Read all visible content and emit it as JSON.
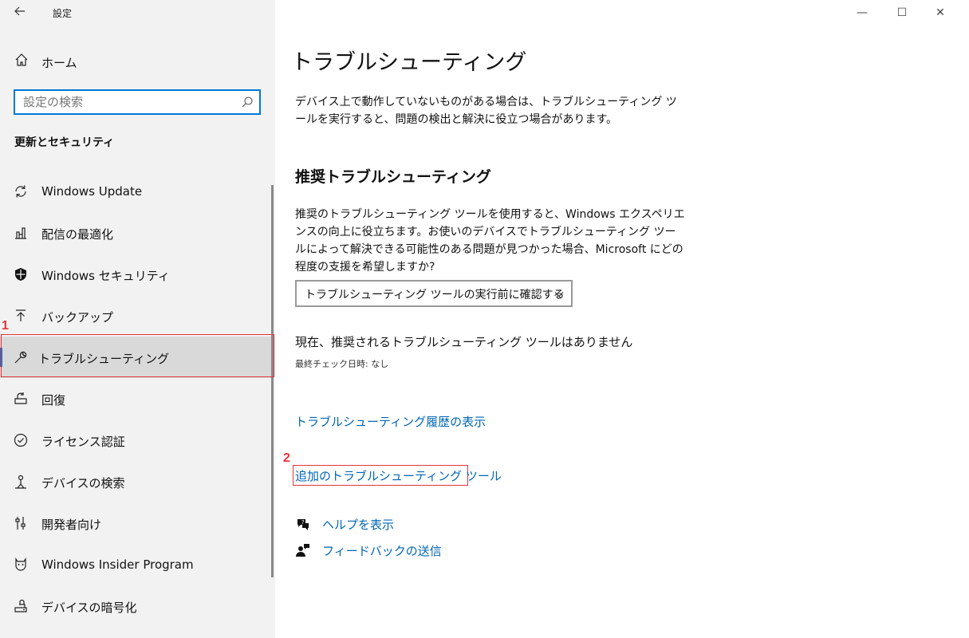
{
  "window": {
    "title": "設定",
    "controls": {
      "minimize": "—",
      "maximize": "☐",
      "close": "✕"
    }
  },
  "sidebar": {
    "home_label": "ホーム",
    "search_placeholder": "設定の検索",
    "section_heading": "更新とセキュリティ",
    "items": [
      {
        "label": "Windows Update",
        "icon": "sync-icon"
      },
      {
        "label": "配信の最適化",
        "icon": "delivery-optimization-icon"
      },
      {
        "label": "Windows セキュリティ",
        "icon": "shield-icon"
      },
      {
        "label": "バックアップ",
        "icon": "upload-arrow-icon"
      },
      {
        "label": "トラブルシューティング",
        "icon": "wrench-icon",
        "selected": true
      },
      {
        "label": "回復",
        "icon": "recovery-icon"
      },
      {
        "label": "ライセンス認証",
        "icon": "check-circle-icon"
      },
      {
        "label": "デバイスの検索",
        "icon": "person-locate-icon"
      },
      {
        "label": "開発者向け",
        "icon": "developer-sliders-icon"
      },
      {
        "label": "Windows Insider Program",
        "icon": "insider-cat-icon"
      },
      {
        "label": "デバイスの暗号化",
        "icon": "lock-drive-icon"
      }
    ]
  },
  "main": {
    "title": "トラブルシューティング",
    "intro": "デバイス上で動作していないものがある場合は、トラブルシューティング ツールを実行すると、問題の検出と解決に役立つ場合があります。",
    "recommended_heading": "推奨トラブルシューティング",
    "recommended_desc": "推奨のトラブルシューティング ツールを使用すると、Windows エクスペリエンスの向上に役立ちます。お使いのデバイスでトラブルシューティング ツールによって解決できる可能性のある問題が見つかった場合、Microsoft にどの程度の支援を希望しますか?",
    "dropdown_value": "トラブルシューティング ツールの実行前に確認する",
    "status": "現在、推奨されるトラブルシューティング ツールはありません",
    "last_check": "最終チェック日時: なし",
    "history_link": "トラブルシューティング履歴の表示",
    "additional_link": "追加のトラブルシューティング ツール",
    "help_link": "ヘルプを表示",
    "feedback_link": "フィードバックの送信"
  },
  "annotations": {
    "one": "1",
    "two": "2"
  },
  "colors": {
    "accent": "#0078d7",
    "link": "#0066b4",
    "annotation": "#e2353a"
  }
}
